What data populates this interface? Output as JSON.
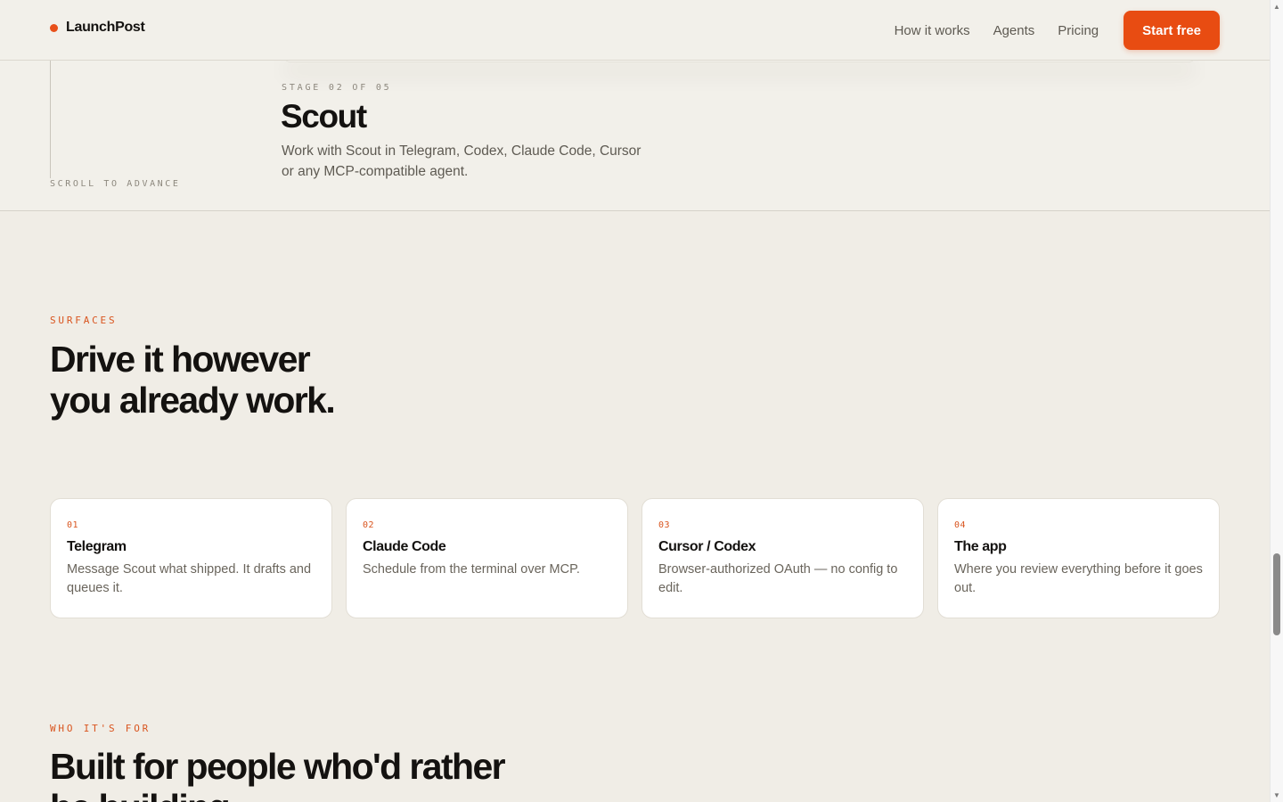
{
  "brand": {
    "name": "LaunchPost",
    "accent_color": "#e84c12"
  },
  "nav": {
    "links": [
      "How it works",
      "Agents",
      "Pricing"
    ],
    "cta_label": "Start free"
  },
  "stage": {
    "scroll_hint": "SCROLL TO ADVANCE",
    "counter": "STAGE 02 OF 05",
    "title": "Scout",
    "description": "Work with Scout in Telegram, Codex, Claude Code, Cursor or any MCP-compatible agent."
  },
  "surfaces": {
    "eyebrow": "SURFACES",
    "title": "Drive it however you already work.",
    "cards": [
      {
        "num": "01",
        "title": "Telegram",
        "desc": "Message Scout what shipped. It drafts and queues it."
      },
      {
        "num": "02",
        "title": "Claude Code",
        "desc": "Schedule from the terminal over MCP."
      },
      {
        "num": "03",
        "title": "Cursor / Codex",
        "desc": "Browser-authorized OAuth — no config to edit."
      },
      {
        "num": "04",
        "title": "The app",
        "desc": "Where you review everything before it goes out."
      }
    ]
  },
  "who": {
    "eyebrow": "WHO IT'S FOR",
    "title": "Built for people who'd rather be building."
  }
}
